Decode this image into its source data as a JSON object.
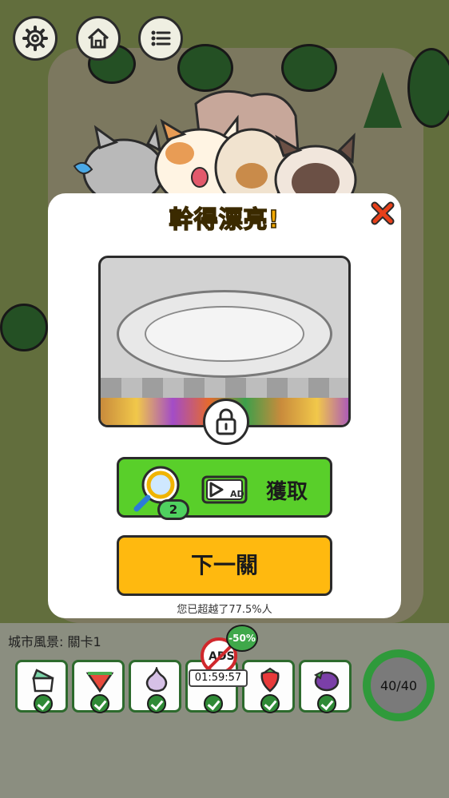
{
  "colors": {
    "title": "#f3a800",
    "get_button": "#59cf2a",
    "next_button": "#ffb90f",
    "close": "#e8401a",
    "progress_ring": "#2f9a3b",
    "no_ads": "#d0282c"
  },
  "top_bar": {
    "settings_icon": "gear-icon",
    "home_icon": "home-icon",
    "menu_icon": "list-icon"
  },
  "modal": {
    "title": "幹得漂亮!",
    "close_icon": "close-x-icon",
    "preview_locked": true,
    "get_button": {
      "icon": "magnifier-icon",
      "count": "2",
      "ad_icon": "watch-ad-icon",
      "ad_text": "AD",
      "label": "獲取"
    },
    "next_button": "下一關",
    "exceed_text": "您已超越了77.5%人"
  },
  "bottom": {
    "level_label": "城市風景: 關卡1",
    "items": [
      {
        "name": "cake",
        "found": true
      },
      {
        "name": "watermelon",
        "found": true
      },
      {
        "name": "garlic",
        "found": true
      },
      {
        "name": "hidden",
        "found": true
      },
      {
        "name": "strawberry",
        "found": true
      },
      {
        "name": "eggplant",
        "found": true
      }
    ],
    "progress": "40/40",
    "progress_fraction": 1.0,
    "no_ads": {
      "text": "ADS",
      "discount": "-50%",
      "timer": "01:59:57"
    }
  }
}
